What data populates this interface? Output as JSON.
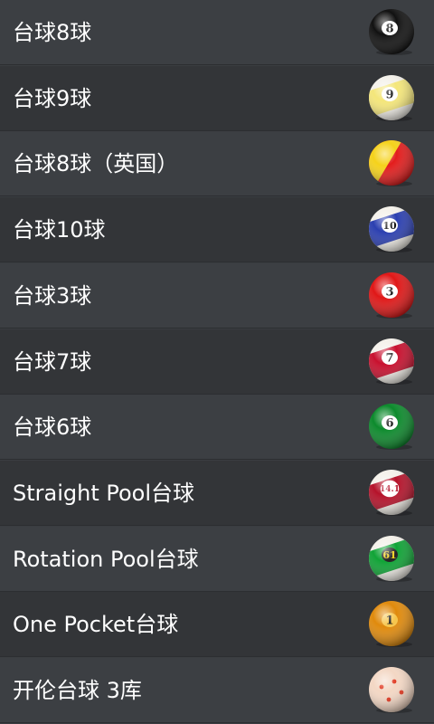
{
  "game_list": {
    "items": [
      {
        "label": "台球8球",
        "ball": {
          "icon": "eight-ball-icon",
          "number": "8",
          "style": "solid",
          "color": "#111111",
          "dot": "#ffffff",
          "dot_text": "#111111"
        }
      },
      {
        "label": "台球9球",
        "ball": {
          "icon": "nine-ball-icon",
          "number": "9",
          "style": "stripe",
          "color": "#f4e67a",
          "dot": "#ffffff",
          "dot_text": "#111111"
        }
      },
      {
        "label": "台球8球（英国）",
        "ball": {
          "icon": "uk-pool-ball-icon",
          "number": "",
          "style": "split",
          "color": "#e31c1c",
          "color2": "#f5d21b",
          "dot": "",
          "dot_text": ""
        }
      },
      {
        "label": "台球10球",
        "ball": {
          "icon": "ten-ball-icon",
          "number": "10",
          "style": "stripe",
          "color": "#2b3fb0",
          "dot": "#ffffff",
          "dot_text": "#111111"
        }
      },
      {
        "label": "台球3球",
        "ball": {
          "icon": "three-ball-icon",
          "number": "3",
          "style": "solid",
          "color": "#e01717",
          "dot": "#ffffff",
          "dot_text": "#111111"
        }
      },
      {
        "label": "台球7球",
        "ball": {
          "icon": "seven-ball-icon",
          "number": "7",
          "style": "stripe",
          "color": "#c8102e",
          "dot": "#ffffff",
          "dot_text": "#111111"
        }
      },
      {
        "label": "台球6球",
        "ball": {
          "icon": "six-ball-icon",
          "number": "6",
          "style": "solid",
          "color": "#0c8a2c",
          "dot": "#ffffff",
          "dot_text": "#111111"
        }
      },
      {
        "label": "Straight Pool台球",
        "ball": {
          "icon": "straight-pool-ball-icon",
          "number": "14.1",
          "style": "stripe",
          "color": "#b5122a",
          "dot": "#ffffff",
          "dot_text": "#b5122a"
        }
      },
      {
        "label": "Rotation Pool台球",
        "ball": {
          "icon": "rotation-pool-ball-icon",
          "number": "61",
          "style": "stripe",
          "color": "#10a336",
          "dot": "#222222",
          "dot_text": "#f5d21b"
        }
      },
      {
        "label": "One Pocket台球",
        "ball": {
          "icon": "one-pocket-ball-icon",
          "number": "1",
          "style": "solid",
          "color": "#e08a0c",
          "dot": "#f6c54a",
          "dot_text": "#111111"
        }
      },
      {
        "label": "开伦台球 3库",
        "ball": {
          "icon": "carom-ball-icon",
          "number": "",
          "style": "carom",
          "color": "#f3d7c4",
          "dot": "#e0341c",
          "dot_text": ""
        }
      }
    ]
  }
}
